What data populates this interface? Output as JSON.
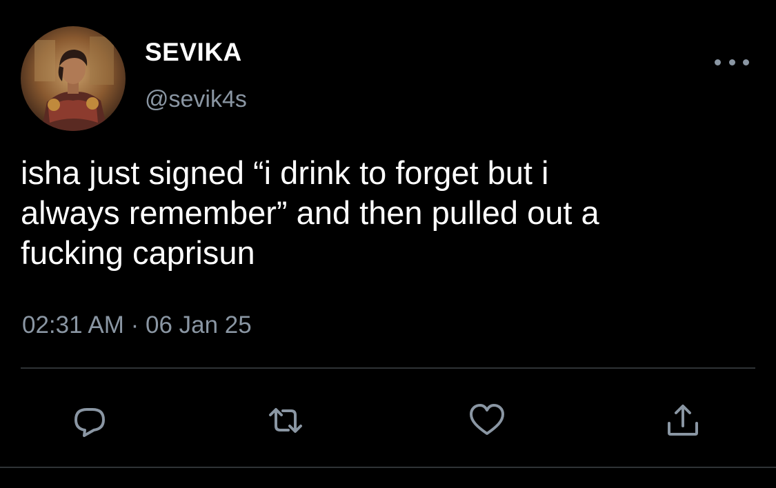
{
  "user": {
    "display_name": "SEVIKA",
    "handle": "@sevik4s"
  },
  "tweet": {
    "text": "isha just signed “i drink to forget but i\nalways remember” and then pulled out a\nfucking caprisun",
    "timestamp": "02:31 AM · 06 Jan 25"
  },
  "icons": {
    "more": "more-horizontal-icon",
    "reply": "reply-icon",
    "retweet": "retweet-icon",
    "like": "heart-icon",
    "share": "share-icon"
  },
  "colors": {
    "background": "#000000",
    "text_primary": "#ffffff",
    "text_secondary": "#8a96a3",
    "divider": "#2f3336"
  }
}
